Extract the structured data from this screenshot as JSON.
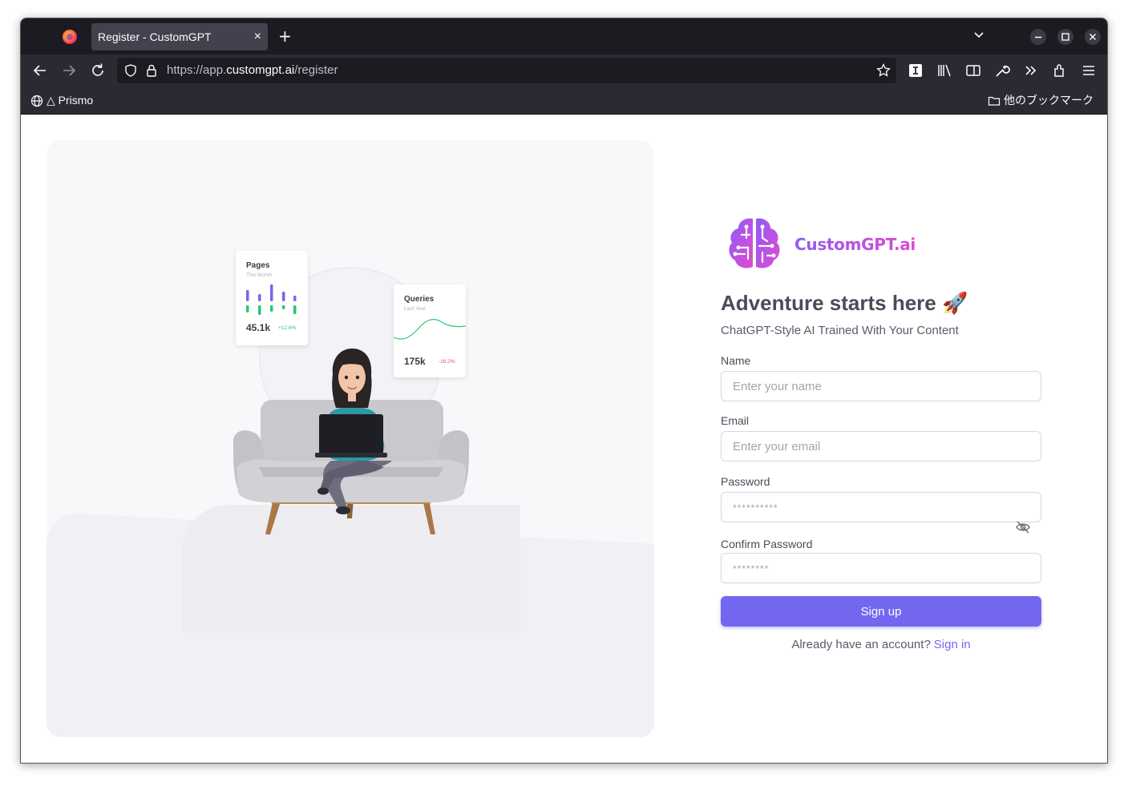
{
  "browser": {
    "tab_title": "Register - CustomGPT",
    "tab_close": "×",
    "new_tab": "+",
    "url_prefix": "https://app.",
    "url_host": "customgpt.ai",
    "url_path": "/register",
    "bookmarks": [
      {
        "label": "△ Prismo"
      },
      {
        "label": "他のブックマーク"
      }
    ]
  },
  "illustration": {
    "pages_card": {
      "title": "Pages",
      "subtitle": "This Month",
      "value": "45.1k",
      "change": "+12.6%"
    },
    "queries_card": {
      "title": "Queries",
      "subtitle": "Last Year",
      "value": "175k",
      "change": "-16.2%"
    },
    "colors": {
      "up": "#28c76f",
      "down": "#ea5455",
      "bar": "#7367f0"
    }
  },
  "brand": {
    "name": "CustomGPT.ai"
  },
  "form": {
    "heading": "Adventure starts here 🚀",
    "subheading": "ChatGPT-Style AI Trained With Your Content",
    "name_label": "Name",
    "name_placeholder": "Enter your name",
    "email_label": "Email",
    "email_placeholder": "Enter your email",
    "password_label": "Password",
    "password_placeholder": "**********",
    "confirm_label": "Confirm Password",
    "confirm_placeholder": "********",
    "submit_label": "Sign up",
    "already_text": "Already have an account?",
    "signin_label": "Sign in",
    "accent": "#7367f0"
  }
}
